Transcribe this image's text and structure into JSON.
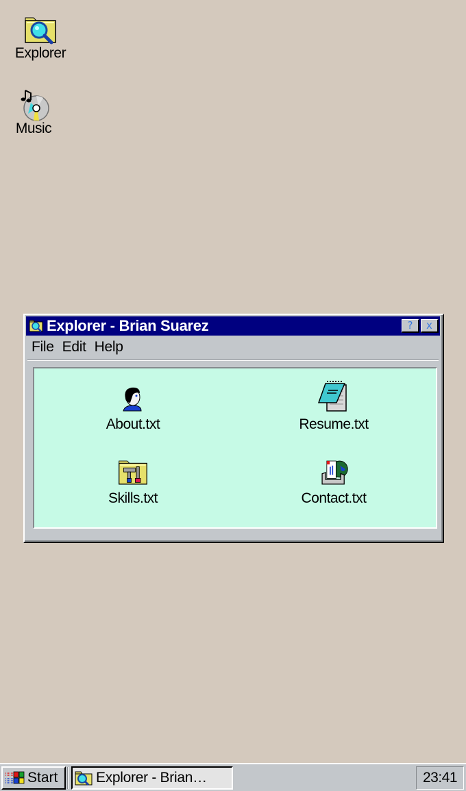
{
  "desktop": {
    "icons": [
      {
        "label": "Explorer",
        "icon": "explorer-folder-magnifier-icon"
      },
      {
        "label": "Music",
        "icon": "music-cd-icon"
      }
    ]
  },
  "window": {
    "title": "Explorer - Brian Suarez",
    "title_icon": "explorer-folder-magnifier-icon",
    "help_button": "?",
    "close_button": "x",
    "menu": [
      "File",
      "Edit",
      "Help"
    ],
    "background_color": "#c6fae6",
    "titlebar_color": "#000080",
    "files": [
      {
        "label": "About.txt",
        "icon": "person-icon"
      },
      {
        "label": "Resume.txt",
        "icon": "notepad-icon"
      },
      {
        "label": "Skills.txt",
        "icon": "tools-folder-icon"
      },
      {
        "label": "Contact.txt",
        "icon": "mail-globe-icon"
      }
    ]
  },
  "taskbar": {
    "start_label": "Start",
    "tasks": [
      {
        "label": "Explorer - Brian…",
        "icon": "explorer-folder-magnifier-icon",
        "active": true
      }
    ],
    "clock": "23:41"
  }
}
